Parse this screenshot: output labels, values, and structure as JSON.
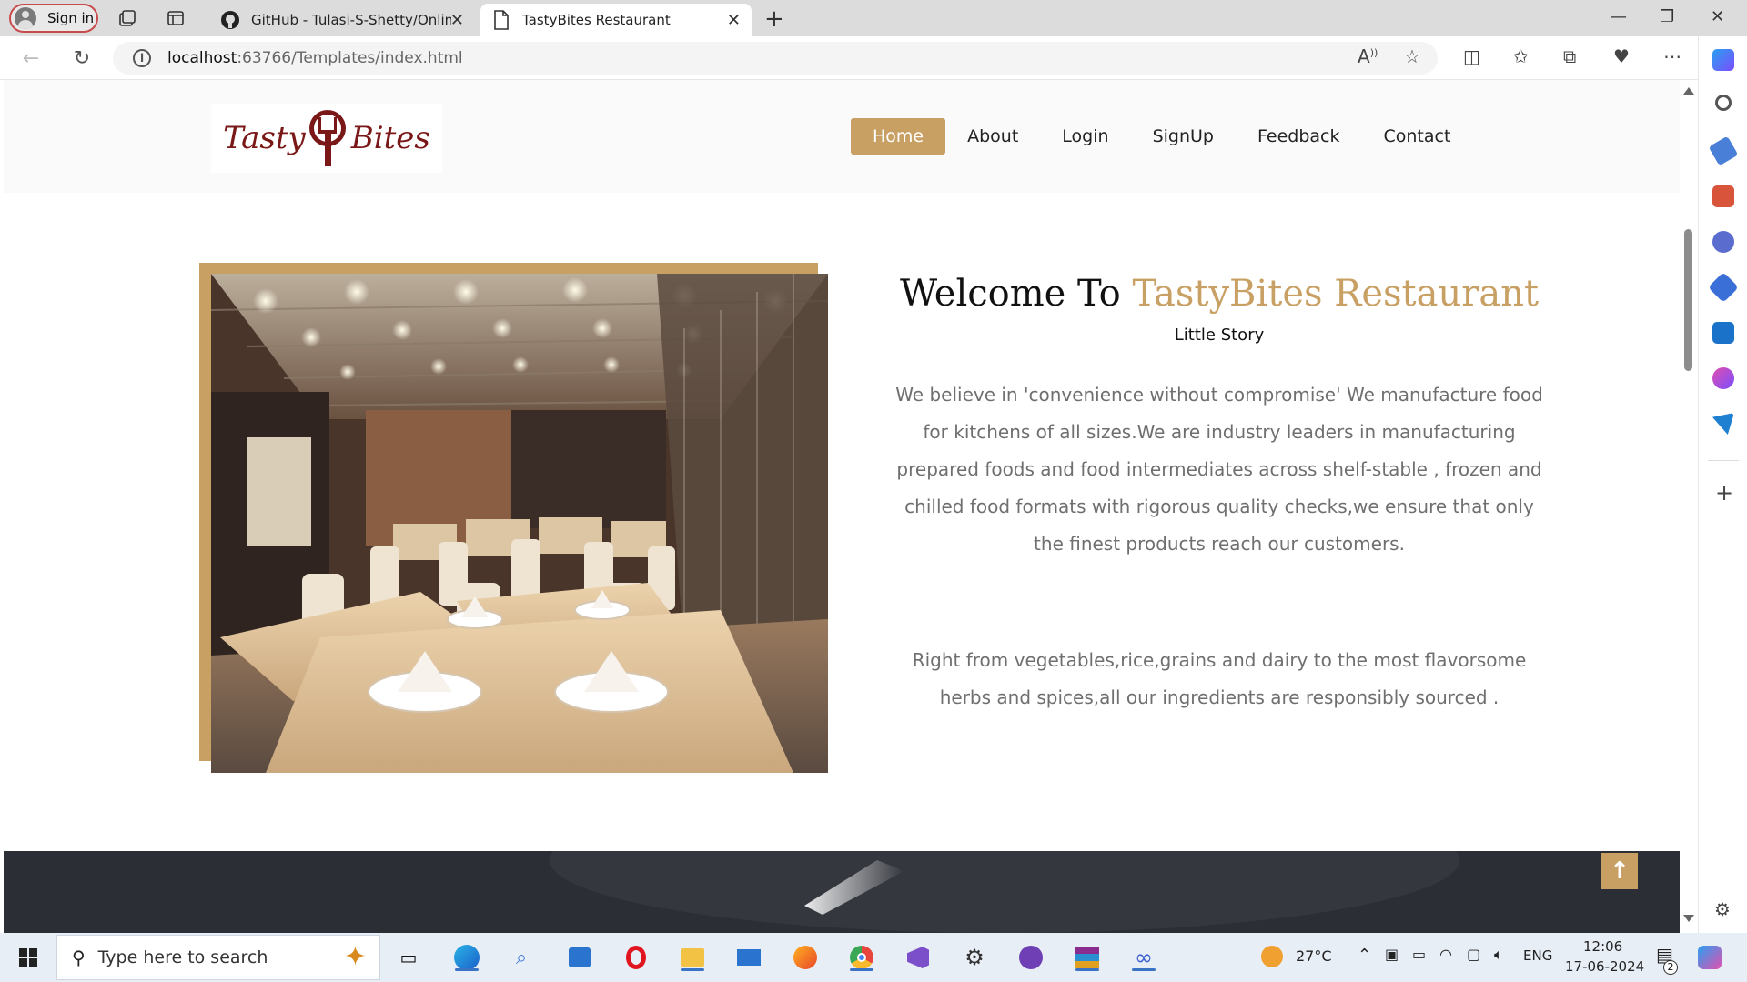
{
  "browser": {
    "signin_label": "Sign in",
    "tabs": [
      {
        "title": "GitHub - Tulasi-S-Shetty/Online-",
        "active": false
      },
      {
        "title": "TastyBites Restaurant",
        "active": true
      }
    ],
    "url_host": "localhost",
    "url_rest": ":63766/Templates/index.html"
  },
  "site": {
    "logo_left": "Tasty",
    "logo_right": "Bites",
    "nav": [
      {
        "label": "Home",
        "active": true
      },
      {
        "label": "About",
        "active": false
      },
      {
        "label": "Login",
        "active": false
      },
      {
        "label": "SignUp",
        "active": false
      },
      {
        "label": "Feedback",
        "active": false
      },
      {
        "label": "Contact",
        "active": false
      }
    ],
    "welcome_prefix": "Welcome To",
    "welcome_accent": "TastyBites Restaurant",
    "subtitle": "Little Story",
    "para1_lines": [
      "We believe in 'convenience without compromise' We manufacture food",
      "for kitchens of all sizes.We are industry leaders in manufacturing",
      "prepared foods and food intermediates across shelf-stable , frozen and",
      "chilled food formats with rigorous quality checks,we ensure that only",
      "the finest products reach our customers."
    ],
    "para2_lines": [
      "Right from vegetables,rice,grains and dairy to the most flavorsome",
      "herbs and spices,all our ingredients are responsibly sourced ."
    ],
    "accent_color": "#c9a063",
    "back_to_top_icon": "arrow-up-icon"
  },
  "taskbar": {
    "search_placeholder": "Type here to search",
    "weather": "27°C",
    "language": "ENG",
    "time": "12:06",
    "date": "17-06-2024",
    "notification_count": "2"
  }
}
